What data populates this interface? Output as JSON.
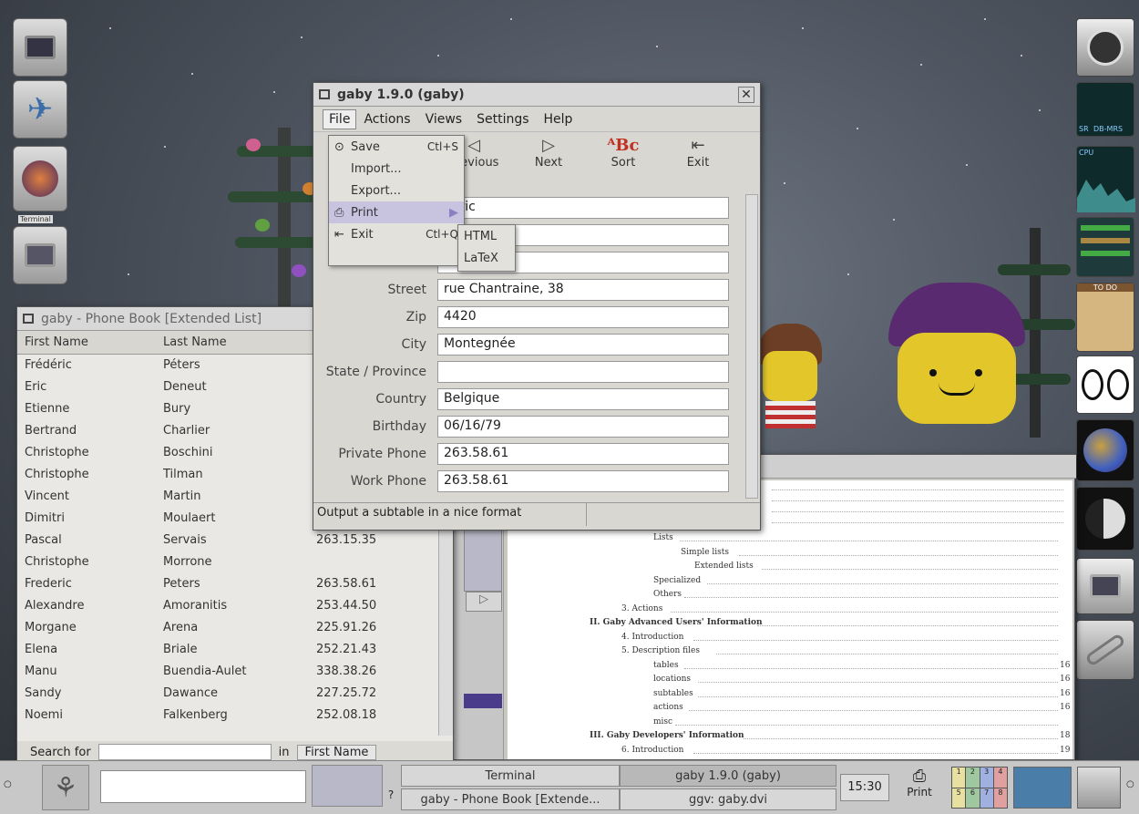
{
  "desktop": {
    "left_dock": {
      "terminal_label": "Terminal"
    },
    "right_dock": {
      "todo_label": "TO DO",
      "sensor_labels": [
        "SR",
        "DB-MRS",
        "CPU"
      ]
    }
  },
  "phonebook": {
    "title": "gaby - Phone Book [Extended List]",
    "columns": [
      "First Name",
      "Last Name",
      ""
    ],
    "rows": [
      [
        "Frédéric",
        "Péters",
        ""
      ],
      [
        "Eric",
        "Deneut",
        ""
      ],
      [
        "Etienne",
        "Bury",
        ""
      ],
      [
        "Bertrand",
        "Charlier",
        ""
      ],
      [
        "Christophe",
        "Boschini",
        ""
      ],
      [
        "Christophe",
        "Tilman",
        ""
      ],
      [
        "Vincent",
        "Martin",
        ""
      ],
      [
        "Dimitri",
        "Moulaert",
        ""
      ],
      [
        "Pascal",
        "Servais",
        "263.15.35"
      ],
      [
        "Christophe",
        "Morrone",
        ""
      ],
      [
        "Frederic",
        "Peters",
        "263.58.61"
      ],
      [
        "Alexandre",
        "Amoranitis",
        "253.44.50"
      ],
      [
        "Morgane",
        "Arena",
        "225.91.26"
      ],
      [
        "Elena",
        "Briale",
        "252.21.43"
      ],
      [
        "Manu",
        "Buendia-Aulet",
        "338.38.26"
      ],
      [
        "Sandy",
        "Dawance",
        "227.25.72"
      ],
      [
        "Noemi",
        "Falkenberg",
        "252.08.18"
      ]
    ],
    "search_label": "Search for",
    "search_value": "",
    "in_label": "in",
    "search_field": "First Name"
  },
  "gaby": {
    "title": "gaby 1.9.0 (gaby)",
    "menubar": [
      "File",
      "Actions",
      "Views",
      "Settings",
      "Help"
    ],
    "toolbar": [
      {
        "label": "Previous",
        "icon": "left-triangle-icon"
      },
      {
        "label": "Next",
        "icon": "right-triangle-icon"
      },
      {
        "label": "Sort",
        "icon": "sort-icon"
      },
      {
        "label": "Exit",
        "icon": "exit-icon"
      }
    ],
    "fields": [
      {
        "label": "",
        "value": "déric"
      },
      {
        "label": "",
        "value": ""
      },
      {
        "label": "",
        "value": ""
      },
      {
        "label": "Street",
        "value": "rue Chantraine, 38"
      },
      {
        "label": "Zip",
        "value": "4420"
      },
      {
        "label": "City",
        "value": "Montegnée"
      },
      {
        "label": "State / Province",
        "value": ""
      },
      {
        "label": "Country",
        "value": "Belgique"
      },
      {
        "label": "Birthday",
        "value": "06/16/79"
      },
      {
        "label": "Private Phone",
        "value": "263.58.61"
      },
      {
        "label": "Work Phone",
        "value": "263.58.61"
      }
    ],
    "status": "Output a subtable in a nice format"
  },
  "file_menu": [
    {
      "label": "Save",
      "accel": "Ctl+S"
    },
    {
      "label": "Import...",
      "accel": ""
    },
    {
      "label": "Export...",
      "accel": ""
    },
    {
      "label": "Print",
      "accel": ""
    },
    {
      "label": "Exit",
      "accel": "Ctl+Q"
    }
  ],
  "print_submenu": [
    "HTML",
    "LaTeX"
  ],
  "ggv": {
    "toc": [
      "Lists",
      "Simple lists",
      "Extended lists",
      "Specialized",
      "Others",
      "3. Actions",
      "II. Gaby Advanced Users' Information",
      "4. Introduction",
      "5. Description files",
      "tables",
      "locations",
      "subtables",
      "actions",
      "misc",
      "III. Gaby Developers' Information",
      "6. Introduction"
    ],
    "pages": [
      "16",
      "16",
      "16",
      "16",
      "18",
      "19"
    ]
  },
  "taskbar": {
    "tasks": [
      "Terminal",
      "gaby 1.9.0 (gaby)",
      "gaby - Phone Book [Extende...",
      "ggv: gaby.dvi"
    ],
    "clock": "15:30",
    "print_label": "Print",
    "pager": [
      "1",
      "2",
      "3",
      "4",
      "5",
      "6",
      "7",
      "8"
    ]
  }
}
